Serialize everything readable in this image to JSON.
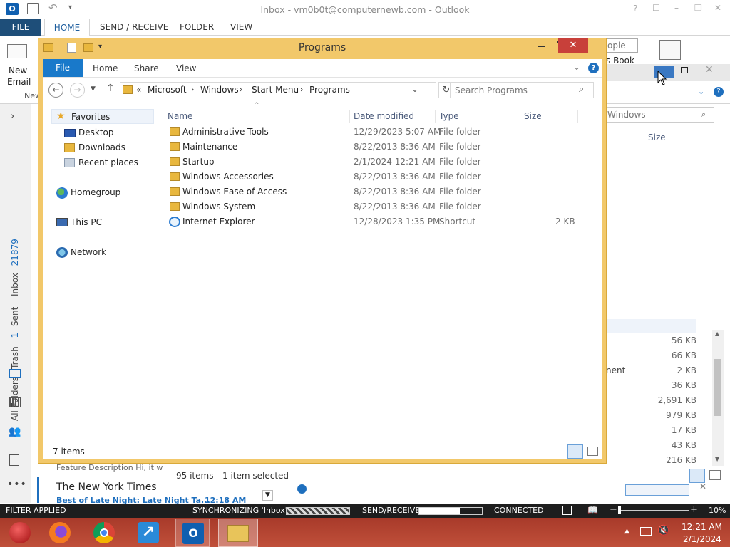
{
  "outlook": {
    "window_title": "Inbox - vm0b0t@computernewb.com - Outlook",
    "title_buttons": [
      "?",
      "☐",
      "–",
      "❐",
      "✕"
    ],
    "tabs": [
      "FILE",
      "HOME",
      "SEND / RECEIVE",
      "FOLDER",
      "VIEW"
    ],
    "ribbon": {
      "new_email_label_1": "New",
      "new_email_label_2": "Email",
      "new_items_partial": "New",
      "people_partial": "ople",
      "address_book_partial": "s Book"
    },
    "nav": {
      "inbox_label": "Inbox",
      "inbox_count": "21879",
      "sent_label": "Sent",
      "trash_label": "Trash",
      "trash_count": "1",
      "all_folders_label": "All Folders"
    },
    "list": {
      "preview_snippet": "Feature Description  Hi,  it w",
      "sender": "The New York Times",
      "subject": "Best of Late Night: Late Night Ta...",
      "time": "12:18 AM"
    },
    "bg_explorer": {
      "search_partial": "Windows",
      "size_header": "Size",
      "name_partial": "nent",
      "sizes": [
        "56 KB",
        "66 KB",
        "2 KB",
        "36 KB",
        "2,691 KB",
        "979 KB",
        "17 KB",
        "43 KB",
        "216 KB"
      ],
      "status_items": "95 items",
      "status_selected": "1 item selected"
    },
    "statusbar": {
      "filter": "FILTER APPLIED",
      "sync": "SYNCHRONIZING  'Inbox'",
      "send_receive": "SEND/RECEIVE",
      "connected": "CONNECTED",
      "zoom": "10%"
    }
  },
  "explorer": {
    "title": "Programs",
    "ribbon_tabs": [
      "File",
      "Home",
      "Share",
      "View"
    ],
    "breadcrumb": [
      "«",
      "Microsoft",
      "Windows",
      "Start Menu",
      "Programs"
    ],
    "search_placeholder": "Search Programs",
    "nav": {
      "favorites": "Favorites",
      "desktop": "Desktop",
      "downloads": "Downloads",
      "recent": "Recent places",
      "homegroup": "Homegroup",
      "this_pc": "This PC",
      "network": "Network"
    },
    "columns": [
      "Name",
      "Date modified",
      "Type",
      "Size"
    ],
    "files": [
      {
        "name": "Administrative Tools",
        "date": "12/29/2023 5:07 AM",
        "type": "File folder",
        "size": ""
      },
      {
        "name": "Maintenance",
        "date": "8/22/2013 8:36 AM",
        "type": "File folder",
        "size": ""
      },
      {
        "name": "Startup",
        "date": "2/1/2024 12:21 AM",
        "type": "File folder",
        "size": ""
      },
      {
        "name": "Windows Accessories",
        "date": "8/22/2013 8:36 AM",
        "type": "File folder",
        "size": ""
      },
      {
        "name": "Windows Ease of Access",
        "date": "8/22/2013 8:36 AM",
        "type": "File folder",
        "size": ""
      },
      {
        "name": "Windows System",
        "date": "8/22/2013 8:36 AM",
        "type": "File folder",
        "size": ""
      },
      {
        "name": "Internet Explorer",
        "date": "12/28/2023 1:35 PM",
        "type": "Shortcut",
        "size": "2 KB"
      }
    ],
    "status": "7 items"
  },
  "taskbar": {
    "time": "12:21 AM",
    "date": "2/1/2024"
  },
  "colors": {
    "explorer_frame": "#f2c86a",
    "explorer_close": "#c8403a",
    "file_tab": "#1979ca",
    "outlook_file_tab": "#1e4e79",
    "taskbar": "#b04530",
    "folder": "#e8b73e"
  }
}
